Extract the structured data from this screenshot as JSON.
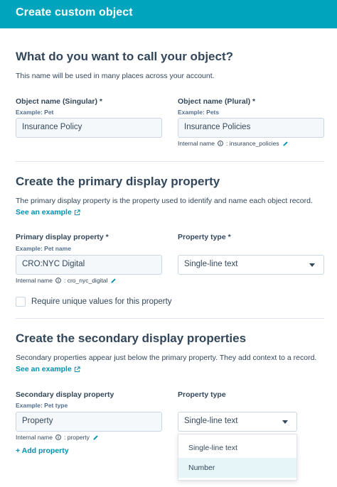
{
  "header": {
    "title": "Create custom object"
  },
  "section1": {
    "heading": "What do you want to call your object?",
    "description": "This name will be used in many places across your account.",
    "singular": {
      "label": "Object name (Singular) *",
      "example": "Example: Pet",
      "value": "Insurance Policy"
    },
    "plural": {
      "label": "Object name (Plural) *",
      "example": "Example: Pets",
      "value": "Insurance Policies"
    },
    "internal": {
      "label": "Internal name",
      "value": ": insurance_policies"
    }
  },
  "section2": {
    "heading": "Create the primary display property",
    "description": "The primary display property is the property used to identify and name each object record.",
    "link": "See an example",
    "property": {
      "label": "Primary display property *",
      "example": "Example: Pet name",
      "value": "CRO:NYC Digital"
    },
    "type": {
      "label": "Property type *",
      "value": "Single-line text"
    },
    "internal": {
      "label": "Internal name",
      "value": ": cro_nyc_digital"
    },
    "checkbox_label": "Require unique values for this property"
  },
  "section3": {
    "heading": "Create the secondary display properties",
    "description": "Secondary properties appear just below the primary property. They add context to a record.",
    "link": "See an example",
    "property": {
      "label": "Secondary display property",
      "example": "Example: Pet type",
      "value": "Property"
    },
    "type": {
      "label": "Property type",
      "value": "Single-line text"
    },
    "internal": {
      "label": "Internal name",
      "value": ": property"
    },
    "add_label": "+ Add property",
    "dropdown_options": [
      "Single-line text",
      "Number"
    ]
  },
  "colors": {
    "header": "#00a4bd",
    "link": "#0091ae",
    "text": "#33475b"
  },
  "icons": [
    "external-link-icon",
    "info-icon",
    "pencil-icon",
    "chevron-down-icon"
  ]
}
